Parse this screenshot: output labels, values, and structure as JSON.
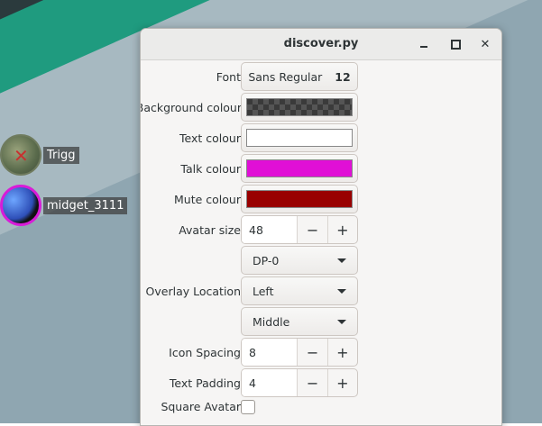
{
  "window": {
    "title": "discover.py"
  },
  "overlay_users": [
    {
      "name": "Trigg",
      "muted": true
    },
    {
      "name": "midget_3111",
      "muted": false
    }
  ],
  "settings": {
    "font": {
      "label": "Font",
      "family": "Sans Regular",
      "size": "12"
    },
    "background_colour": {
      "label": "Background colour",
      "color": "transparent"
    },
    "text_colour": {
      "label": "Text colour",
      "color": "#ffffff"
    },
    "talk_colour": {
      "label": "Talk colour",
      "color": "#e00fd6"
    },
    "mute_colour": {
      "label": "Mute colour",
      "color": "#990000"
    },
    "avatar_size": {
      "label": "Avatar size",
      "value": "48",
      "minus": "−",
      "plus": "+"
    },
    "overlay_location": {
      "label": "Overlay Location",
      "monitor": "DP-0",
      "horizontal": "Left",
      "vertical": "Middle"
    },
    "icon_spacing": {
      "label": "Icon Spacing",
      "value": "8",
      "minus": "−",
      "plus": "+"
    },
    "text_padding": {
      "label": "Text Padding",
      "value": "4",
      "minus": "−",
      "plus": "+"
    },
    "square_avatar": {
      "label": "Square Avatar",
      "checked": false
    }
  },
  "icons": {
    "minimize": "minimize-icon",
    "maximize": "maximize-icon",
    "close": "close-icon",
    "dropdown": "chevron-down-icon"
  }
}
